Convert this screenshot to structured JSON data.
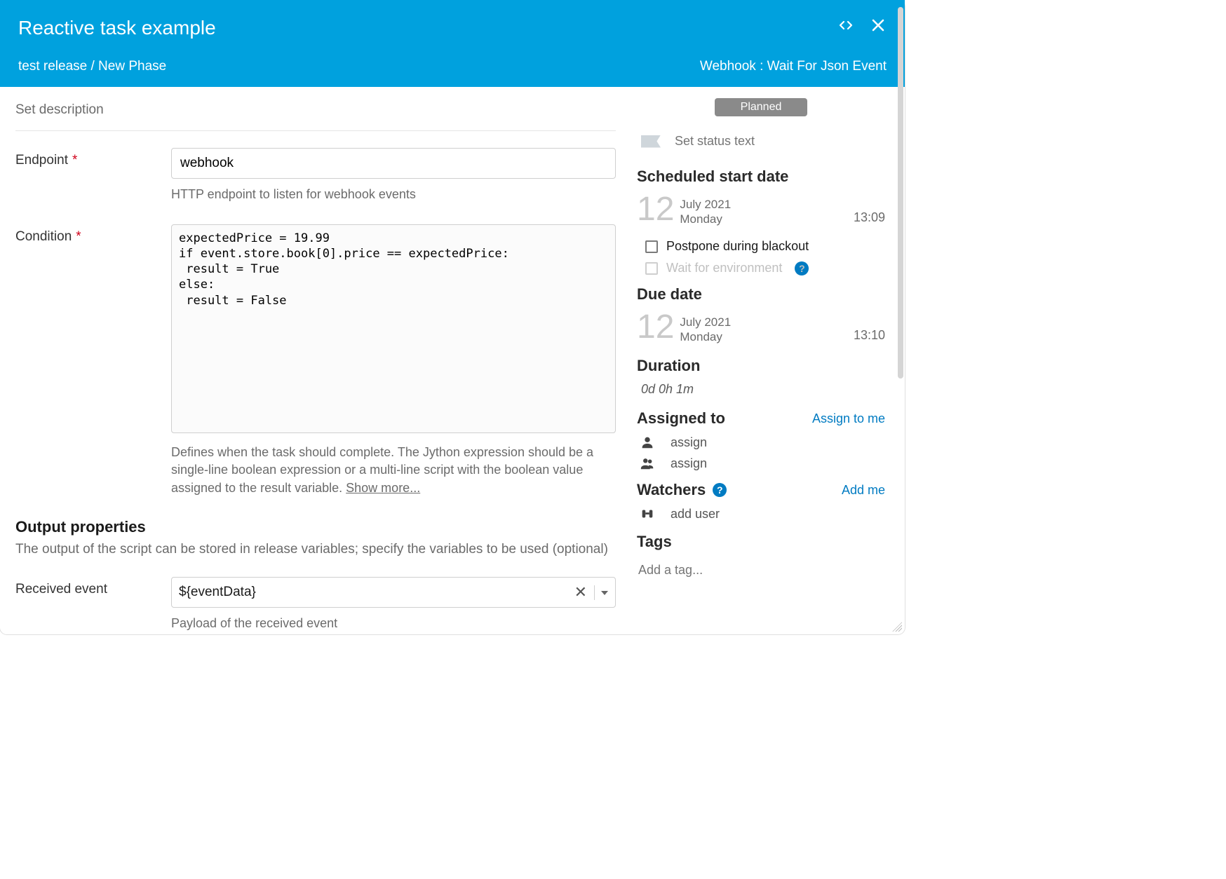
{
  "header": {
    "title": "Reactive task example",
    "breadcrumb": "test release / New Phase",
    "task_type": "Webhook : Wait For Json Event"
  },
  "main": {
    "set_description_placeholder": "Set description",
    "endpoint": {
      "label": "Endpoint",
      "value": "webhook",
      "hint": "HTTP endpoint to listen for webhook events"
    },
    "condition": {
      "label": "Condition",
      "value": "expectedPrice = 19.99\nif event.store.book[0].price == expectedPrice:\n result = True\nelse:\n result = False",
      "hint_pre": "Defines when the task should complete. The Jython expression should be a single-line boolean expression or a multi-line script with the boolean value assigned to the result variable. ",
      "show_more": "Show more..."
    },
    "output": {
      "title": "Output properties",
      "subtitle": "The output of the script can be stored in release variables; specify the variables to be used (optional)"
    },
    "received_event": {
      "label": "Received event",
      "value": "${eventData}",
      "hint": "Payload of the received event"
    }
  },
  "side": {
    "status_pill": "Planned",
    "status_text_placeholder": "Set status text",
    "start": {
      "heading": "Scheduled start date",
      "day": "12",
      "month_year": "July 2021",
      "weekday": "Monday",
      "time": "13:09"
    },
    "postpone_label": "Postpone during blackout",
    "wait_env_label": "Wait for environment",
    "due": {
      "heading": "Due date",
      "day": "12",
      "month_year": "July 2021",
      "weekday": "Monday",
      "time": "13:10"
    },
    "duration": {
      "heading": "Duration",
      "value": "0d 0h 1m"
    },
    "assigned": {
      "heading": "Assigned to",
      "assign_to_me": "Assign to me",
      "single_placeholder": "assign",
      "group_placeholder": "assign"
    },
    "watchers": {
      "heading": "Watchers",
      "add_me": "Add me",
      "add_user_placeholder": "add user"
    },
    "tags": {
      "heading": "Tags",
      "placeholder": "Add a tag..."
    }
  }
}
